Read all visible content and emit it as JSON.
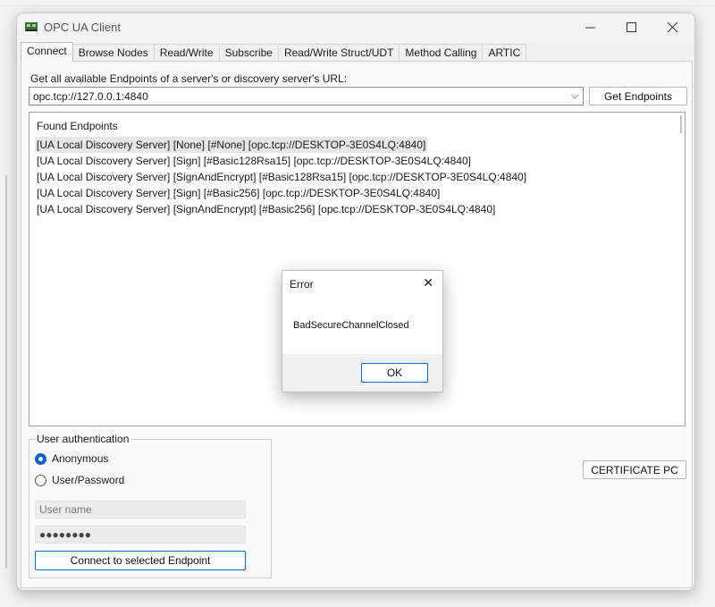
{
  "window": {
    "title": "OPC UA Client"
  },
  "tabs": [
    {
      "label": "Connect"
    },
    {
      "label": "Browse Nodes"
    },
    {
      "label": "Read/Write"
    },
    {
      "label": "Subscribe"
    },
    {
      "label": "Read/Write Struct/UDT"
    },
    {
      "label": "Method Calling"
    },
    {
      "label": "ARTIC"
    }
  ],
  "connect": {
    "url_label": "Get all available Endpoints of a server's or discovery server's URL:",
    "url_value": "opc.tcp://127.0.0.1:4840",
    "get_endpoints_label": "Get Endpoints",
    "endpoints_header": "Found Endpoints",
    "endpoints": [
      "[UA Local Discovery Server]  [None]  [#None]  [opc.tcp://DESKTOP-3E0S4LQ:4840]",
      "[UA Local Discovery Server]  [Sign]  [#Basic128Rsa15]  [opc.tcp://DESKTOP-3E0S4LQ:4840]",
      "[UA Local Discovery Server]  [SignAndEncrypt]  [#Basic128Rsa15]  [opc.tcp://DESKTOP-3E0S4LQ:4840]",
      "[UA Local Discovery Server]  [Sign]  [#Basic256]  [opc.tcp://DESKTOP-3E0S4LQ:4840]",
      "[UA Local Discovery Server]  [SignAndEncrypt]  [#Basic256]  [opc.tcp://DESKTOP-3E0S4LQ:4840]"
    ],
    "auth_legend": "User authentication",
    "anonymous_label": "Anonymous",
    "userpass_label": "User/Password",
    "username_placeholder": "User name",
    "password_value": "●●●●●●●●",
    "connect_label": "Connect to selected Endpoint",
    "certificate_label": "CERTIFICATE PC"
  },
  "dialog": {
    "title": "Error",
    "message": "BadSecureChannelClosed",
    "ok_label": "OK"
  },
  "colors": {
    "accent": "#0b62c9"
  }
}
